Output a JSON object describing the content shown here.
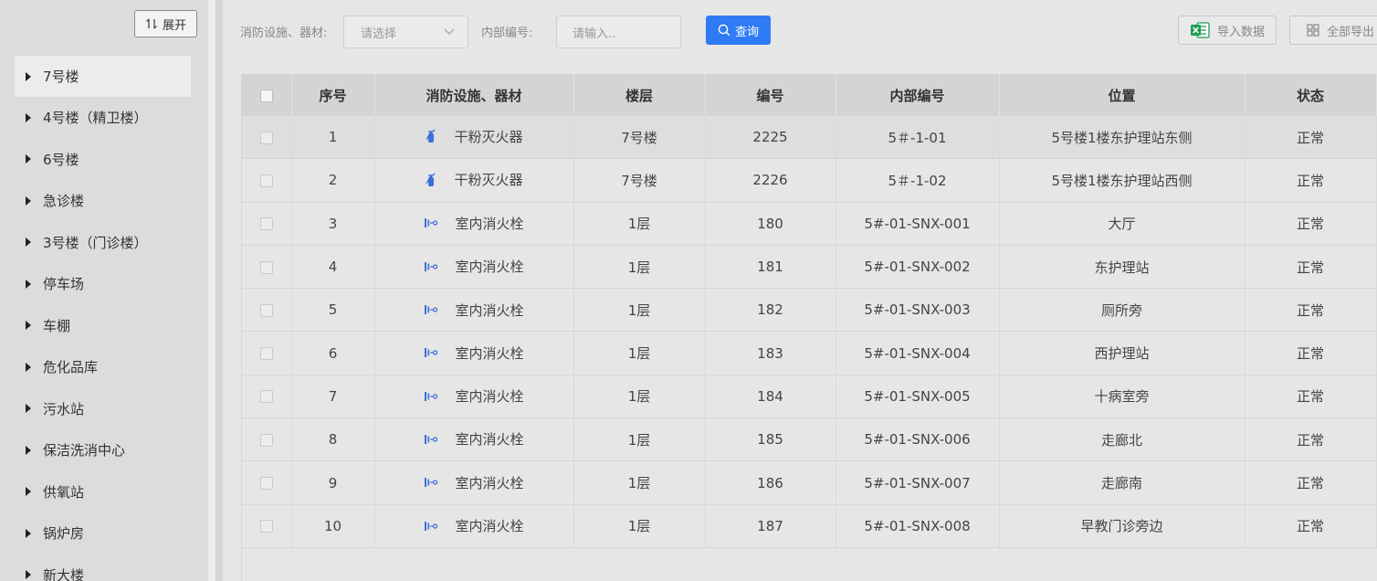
{
  "sidebar": {
    "expand_label": "展开",
    "items": [
      {
        "label": "7号楼",
        "active": true
      },
      {
        "label": "4号楼（精卫楼）"
      },
      {
        "label": "6号楼"
      },
      {
        "label": "急诊楼"
      },
      {
        "label": "3号楼（门诊楼）"
      },
      {
        "label": "停车场"
      },
      {
        "label": "车棚"
      },
      {
        "label": "危化品库"
      },
      {
        "label": "污水站"
      },
      {
        "label": "保洁洗消中心"
      },
      {
        "label": "供氧站"
      },
      {
        "label": "锅炉房"
      },
      {
        "label": "新大楼"
      }
    ]
  },
  "toolbar": {
    "equipment_label": "消防设施、器材:",
    "equipment_placeholder": "请选择",
    "internal_label": "内部编号:",
    "internal_placeholder": "请输入..",
    "query_label": "查询",
    "import_label": "导入数据",
    "export_label": "全部导出"
  },
  "colors": {
    "primary": "#2f7bf5",
    "icon_blue": "#3b6fd6",
    "excel_green": "#1f9d55"
  },
  "table": {
    "headers": [
      "序号",
      "消防设施、器材",
      "楼层",
      "编号",
      "内部编号",
      "位置",
      "状态"
    ],
    "rows": [
      {
        "no": "1",
        "icon": "fire-extinguisher-icon",
        "equipment": "干粉灭火器",
        "floor": "7号楼",
        "code": "2225",
        "internal": "5＃-1-01",
        "location": "5号楼1楼东护理站东侧",
        "status": "正常"
      },
      {
        "no": "2",
        "icon": "fire-extinguisher-icon",
        "equipment": "干粉灭火器",
        "floor": "7号楼",
        "code": "2226",
        "internal": "5＃-1-02",
        "location": "5号楼1楼东护理站西侧",
        "status": "正常"
      },
      {
        "no": "3",
        "icon": "fire-hydrant-icon",
        "equipment": "室内消火栓",
        "floor": "1层",
        "code": "180",
        "internal": "5#-01-SNX-001",
        "location": "大厅",
        "status": "正常"
      },
      {
        "no": "4",
        "icon": "fire-hydrant-icon",
        "equipment": "室内消火栓",
        "floor": "1层",
        "code": "181",
        "internal": "5#-01-SNX-002",
        "location": "东护理站",
        "status": "正常"
      },
      {
        "no": "5",
        "icon": "fire-hydrant-icon",
        "equipment": "室内消火栓",
        "floor": "1层",
        "code": "182",
        "internal": "5#-01-SNX-003",
        "location": "厕所旁",
        "status": "正常"
      },
      {
        "no": "6",
        "icon": "fire-hydrant-icon",
        "equipment": "室内消火栓",
        "floor": "1层",
        "code": "183",
        "internal": "5#-01-SNX-004",
        "location": "西护理站",
        "status": "正常"
      },
      {
        "no": "7",
        "icon": "fire-hydrant-icon",
        "equipment": "室内消火栓",
        "floor": "1层",
        "code": "184",
        "internal": "5#-01-SNX-005",
        "location": "十病室旁",
        "status": "正常"
      },
      {
        "no": "8",
        "icon": "fire-hydrant-icon",
        "equipment": "室内消火栓",
        "floor": "1层",
        "code": "185",
        "internal": "5#-01-SNX-006",
        "location": "走廊北",
        "status": "正常"
      },
      {
        "no": "9",
        "icon": "fire-hydrant-icon",
        "equipment": "室内消火栓",
        "floor": "1层",
        "code": "186",
        "internal": "5#-01-SNX-007",
        "location": "走廊南",
        "status": "正常"
      },
      {
        "no": "10",
        "icon": "fire-hydrant-icon",
        "equipment": "室内消火栓",
        "floor": "1层",
        "code": "187",
        "internal": "5#-01-SNX-008",
        "location": "早教门诊旁边",
        "status": "正常"
      }
    ]
  }
}
